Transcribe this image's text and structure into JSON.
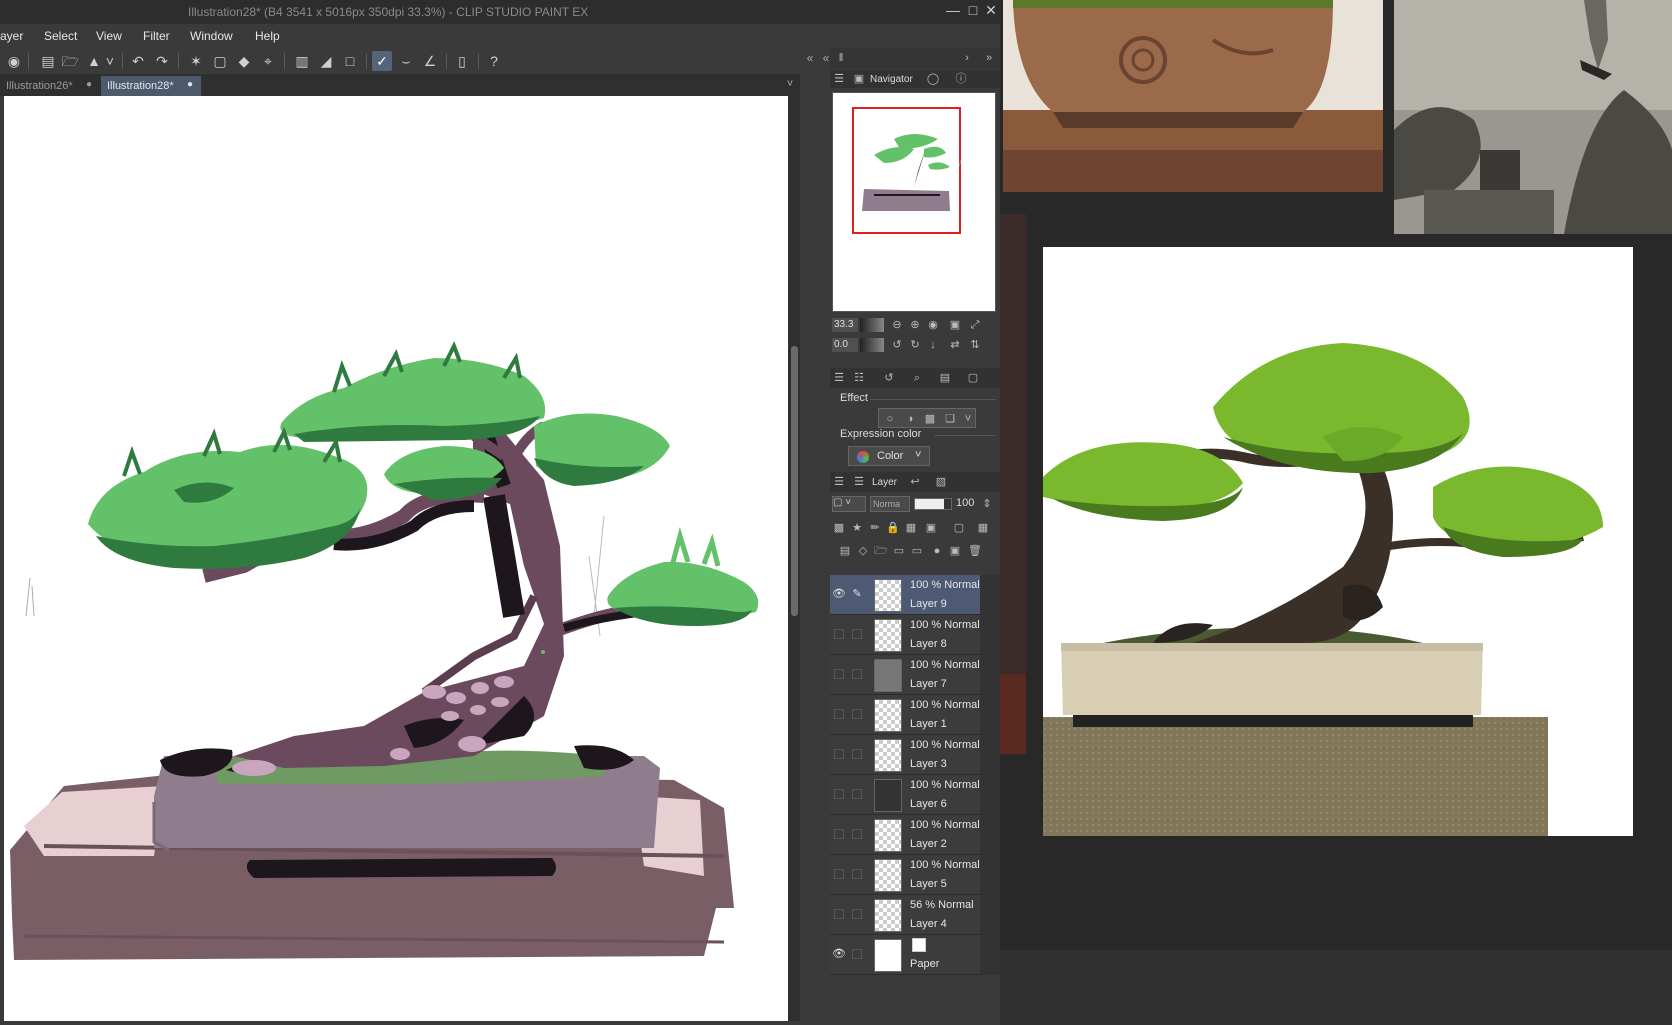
{
  "window": {
    "title": "Illustration28* (B4 3541 x 5016px 350dpi 33.3%)  - CLIP STUDIO PAINT EX"
  },
  "menu": [
    "ayer",
    "Select",
    "View",
    "Filter",
    "Window",
    "Help"
  ],
  "tabs": [
    {
      "label": "Illustration26*"
    },
    {
      "label": "Illustration28*"
    }
  ],
  "tab_dirty_mark": "●",
  "navigator": {
    "title": "Navigator",
    "zoom": "33.3",
    "rotation": "0.0"
  },
  "property": {
    "effect_label": "Effect",
    "expression_color_label": "Expression color",
    "expression_color_value": "Color"
  },
  "layer_panel": {
    "title": "Layer",
    "blend_mode": "Norma",
    "opacity": "100"
  },
  "layers": [
    {
      "mode": "100 % Normal",
      "name": "Layer 9"
    },
    {
      "mode": "100 % Normal",
      "name": "Layer 8"
    },
    {
      "mode": "100 % Normal",
      "name": "Layer 7"
    },
    {
      "mode": "100 % Normal",
      "name": "Layer 1"
    },
    {
      "mode": "100 % Normal",
      "name": "Layer 3"
    },
    {
      "mode": "100 % Normal",
      "name": "Layer 6"
    },
    {
      "mode": "100 % Normal",
      "name": "Layer 2"
    },
    {
      "mode": "100 % Normal",
      "name": "Layer 5"
    },
    {
      "mode": "56 % Normal",
      "name": "Layer 4"
    },
    {
      "mode": "",
      "name": "Paper"
    }
  ],
  "colors": {
    "foliage_light": "#63c16a",
    "foliage_dark": "#2f7a3e",
    "trunk": "#6b4a5e",
    "trunk_dark": "#1e161d",
    "pot_top": "#8f7c8c",
    "pot_body": "#7a5e66",
    "pot_highlight": "#e8cfd2",
    "moss": "#6f9a63",
    "selected_layer": "#4e5a74",
    "active_tool": "#55647a",
    "navigator_frame": "#e0201c"
  }
}
